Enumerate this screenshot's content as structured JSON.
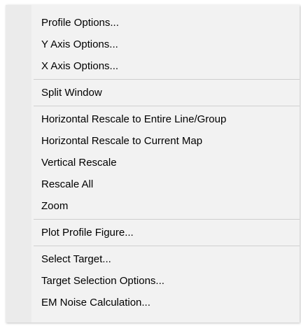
{
  "context_menu": {
    "groups": [
      [
        "Profile Options...",
        "Y Axis Options...",
        "X Axis Options..."
      ],
      [
        "Split Window"
      ],
      [
        "Horizontal Rescale to Entire Line/Group",
        "Horizontal Rescale to Current Map",
        "Vertical Rescale",
        "Rescale All",
        "Zoom"
      ],
      [
        "Plot Profile Figure..."
      ],
      [
        "Select Target...",
        "Target Selection Options...",
        "EM Noise Calculation..."
      ]
    ]
  }
}
